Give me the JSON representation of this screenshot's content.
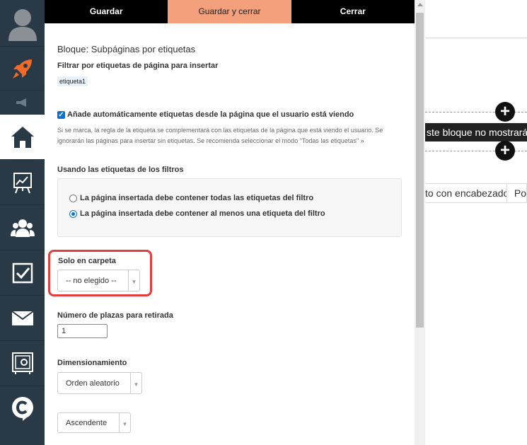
{
  "sidebar": {
    "icons": [
      "user-avatar-icon",
      "rocket-icon",
      "megaphone-icon",
      "home-icon",
      "chart-icon",
      "users-icon",
      "checkbox-icon",
      "mail-icon",
      "safe-icon",
      "c-logo-icon"
    ],
    "active": "home-icon"
  },
  "toolbar": {
    "save_label": "Guardar",
    "save_close_label": "Guardar y cerrar",
    "close_label": "Cerrar",
    "accent_color": "#f4a07c"
  },
  "form": {
    "block_title": "Bloque: Subpáginas por etiquetas",
    "filter_label": "Filtrar por etiquetas de página para insertar",
    "tag": "etiqueta1",
    "auto_tags_label": "Añade automáticamente etiquetas desde la página que el usuario está viendo",
    "auto_tags_checked": true,
    "auto_tags_help": "Si se marca, la regla de la etiqueta se complementará con las etiquetas de la página que está viendo el usuario. Se ignorarán las páginas para insertar sin etiquetas. Se recomienda seleccionar el modo \"Todas las etiquetas\" »",
    "filter_mode_label": "Usando las etiquetas de los filtros",
    "filter_mode_options": [
      "La página insertada debe contener todas las etiquetas del filtro",
      "La página insertada debe contener al menos una etiqueta del filtro"
    ],
    "filter_mode_selected": 1,
    "folder_label": "Solo en carpeta",
    "folder_value": "-- no elegido --",
    "places_label": "Número de plazas para retirada",
    "places_value": "1",
    "sizing_label": "Dimensionamiento",
    "sizing_value": "Orden aleatorio",
    "order_value": "Ascendente"
  },
  "background": {
    "notice": "ste bloque no mostrará m",
    "tab1": "to con encabezado",
    "tab2": "Po"
  }
}
